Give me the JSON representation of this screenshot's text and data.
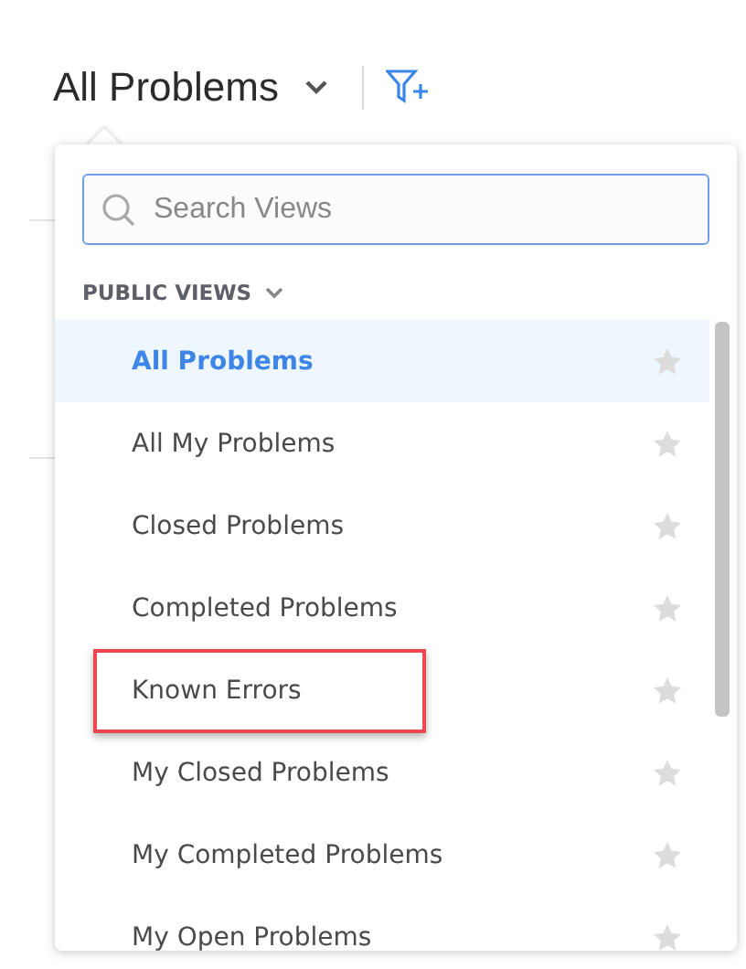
{
  "header": {
    "title": "All Problems"
  },
  "views_panel": {
    "search": {
      "placeholder": "Search Views"
    },
    "section": {
      "label": "PUBLIC VIEWS",
      "expanded": true
    },
    "items": [
      {
        "label": "All Problems",
        "selected": true,
        "starred": false,
        "highlighted": false
      },
      {
        "label": "All My Problems",
        "selected": false,
        "starred": false,
        "highlighted": false
      },
      {
        "label": "Closed Problems",
        "selected": false,
        "starred": false,
        "highlighted": false
      },
      {
        "label": "Completed Problems",
        "selected": false,
        "starred": false,
        "highlighted": false
      },
      {
        "label": "Known Errors",
        "selected": false,
        "starred": false,
        "highlighted": true
      },
      {
        "label": "My Closed Problems",
        "selected": false,
        "starred": false,
        "highlighted": false
      },
      {
        "label": "My Completed Problems",
        "selected": false,
        "starred": false,
        "highlighted": false
      },
      {
        "label": "My Open Problems",
        "selected": false,
        "starred": false,
        "highlighted": false
      }
    ]
  }
}
